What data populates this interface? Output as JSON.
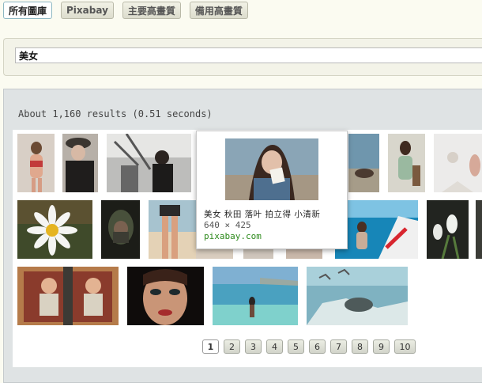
{
  "tabs": [
    {
      "label": "所有圖庫",
      "active": true
    },
    {
      "label": "Pixabay",
      "active": false
    },
    {
      "label": "主要高畫質",
      "active": false
    },
    {
      "label": "備用高畫質",
      "active": false
    }
  ],
  "search": {
    "query": "美女"
  },
  "results": {
    "summary": "About 1,160 results (0.51 seconds)"
  },
  "popup": {
    "title": "美女 秋田 落叶 拍立得 小清新",
    "size": "640 × 425",
    "site": "pixabay.com"
  },
  "pagination": {
    "pages": [
      "1",
      "2",
      "3",
      "4",
      "5",
      "6",
      "7",
      "8",
      "9",
      "10"
    ],
    "current": "1"
  }
}
